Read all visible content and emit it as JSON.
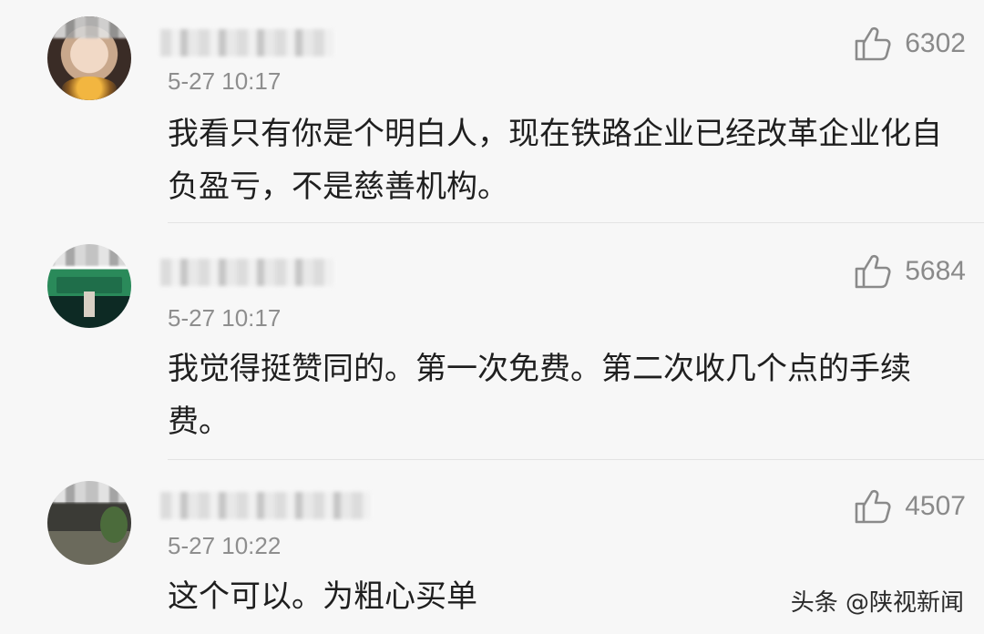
{
  "comments": [
    {
      "time": "5-27 10:17",
      "likes": "6302",
      "text": "我看只有你是个明白人，现在铁路企业已经改革企业化自负盈亏，不是慈善机构。"
    },
    {
      "time": "5-27 10:17",
      "likes": "5684",
      "text": "我觉得挺赞同的。第一次免费。第二次收几个点的手续费。"
    },
    {
      "time": "5-27 10:22",
      "likes": "4507",
      "text": "这个可以。为粗心买单"
    }
  ],
  "watermark": "头条 @陕视新闻",
  "icons": {
    "like": "thumbs-up-icon"
  }
}
